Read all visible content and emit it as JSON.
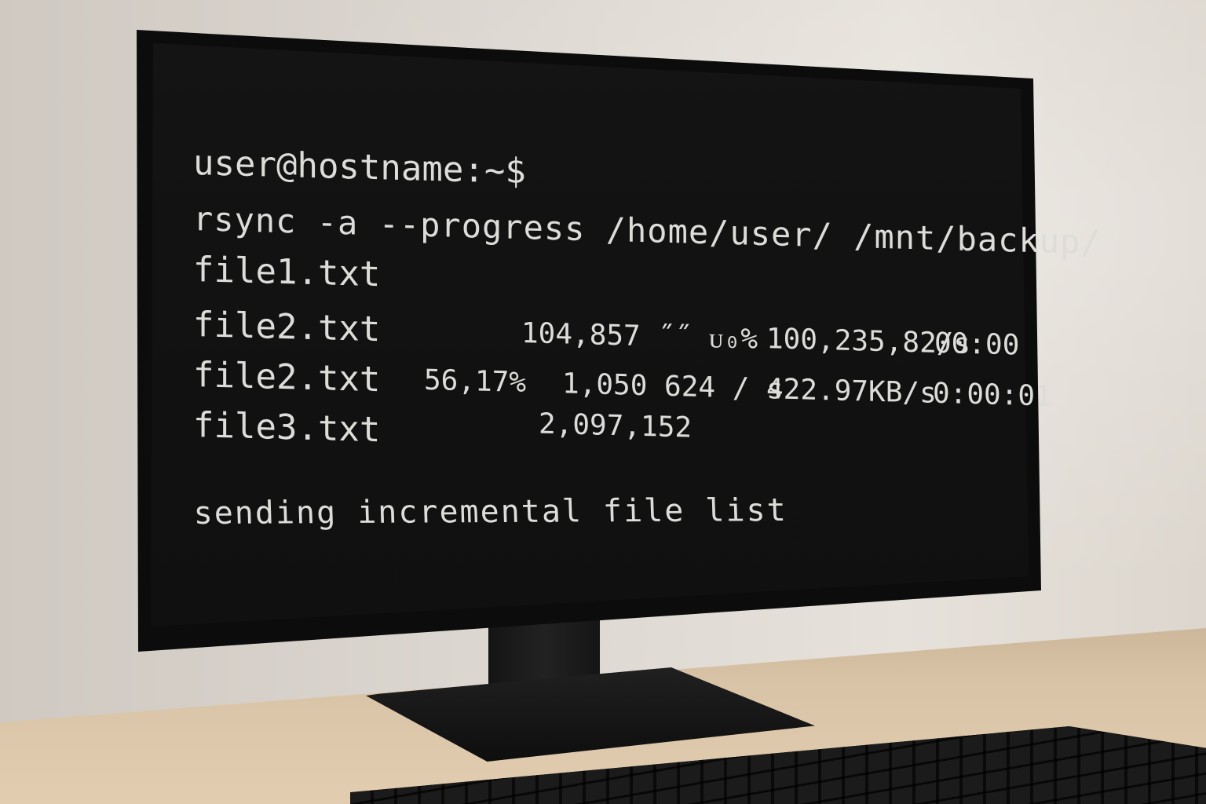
{
  "terminal": {
    "prompt": "user@hostname:~$",
    "command": "rsync -a --progress /home/user/ /mnt/backup/",
    "rows": [
      {
        "file": "file1.txt"
      },
      {
        "file": "file2.txt",
        "bytes": "104,857 ˝˝ ᴜ₀%",
        "rate": "100,235,82/s",
        "time": "00:00"
      },
      {
        "file": "file2.txt",
        "percent": "56,17%",
        "bytes": "1,050 624 / s",
        "rate": "422.97KB/s",
        "time": "0:00:01"
      },
      {
        "file": "file3.txt",
        "bytes": "2,097,152"
      }
    ],
    "status": "sending incremental file list"
  },
  "colors": {
    "text": "#dcdcd8",
    "screen": "#111111",
    "bezel": "#0c0c0c"
  }
}
